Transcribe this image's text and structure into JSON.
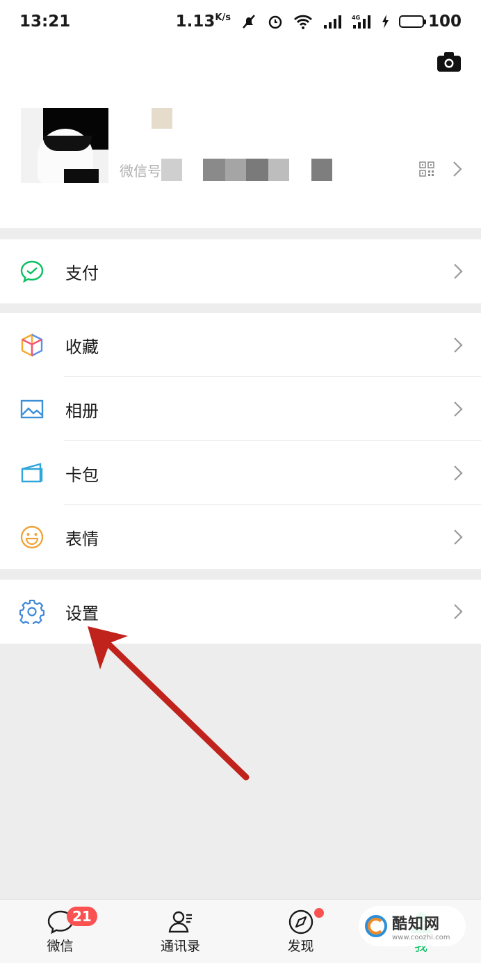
{
  "status_bar": {
    "time": "13:21",
    "speed": "1.13",
    "speed_unit": "K/s",
    "battery": "100"
  },
  "profile": {
    "nickname": "",
    "wechat_id_label": "微信号："
  },
  "menu": {
    "pay": "支付",
    "favorites": "收藏",
    "album": "相册",
    "cards": "卡包",
    "stickers": "表情",
    "settings": "设置"
  },
  "tabbar": {
    "chats": "微信",
    "chats_badge": "21",
    "contacts": "通讯录",
    "discover": "发现",
    "me": "我"
  },
  "watermark": {
    "title": "酷知网",
    "url": "www.coozhi.com"
  },
  "colors": {
    "accent": "#07c160",
    "badge": "#fa5151",
    "arrow": "#c0231b",
    "background": "#ededed"
  }
}
